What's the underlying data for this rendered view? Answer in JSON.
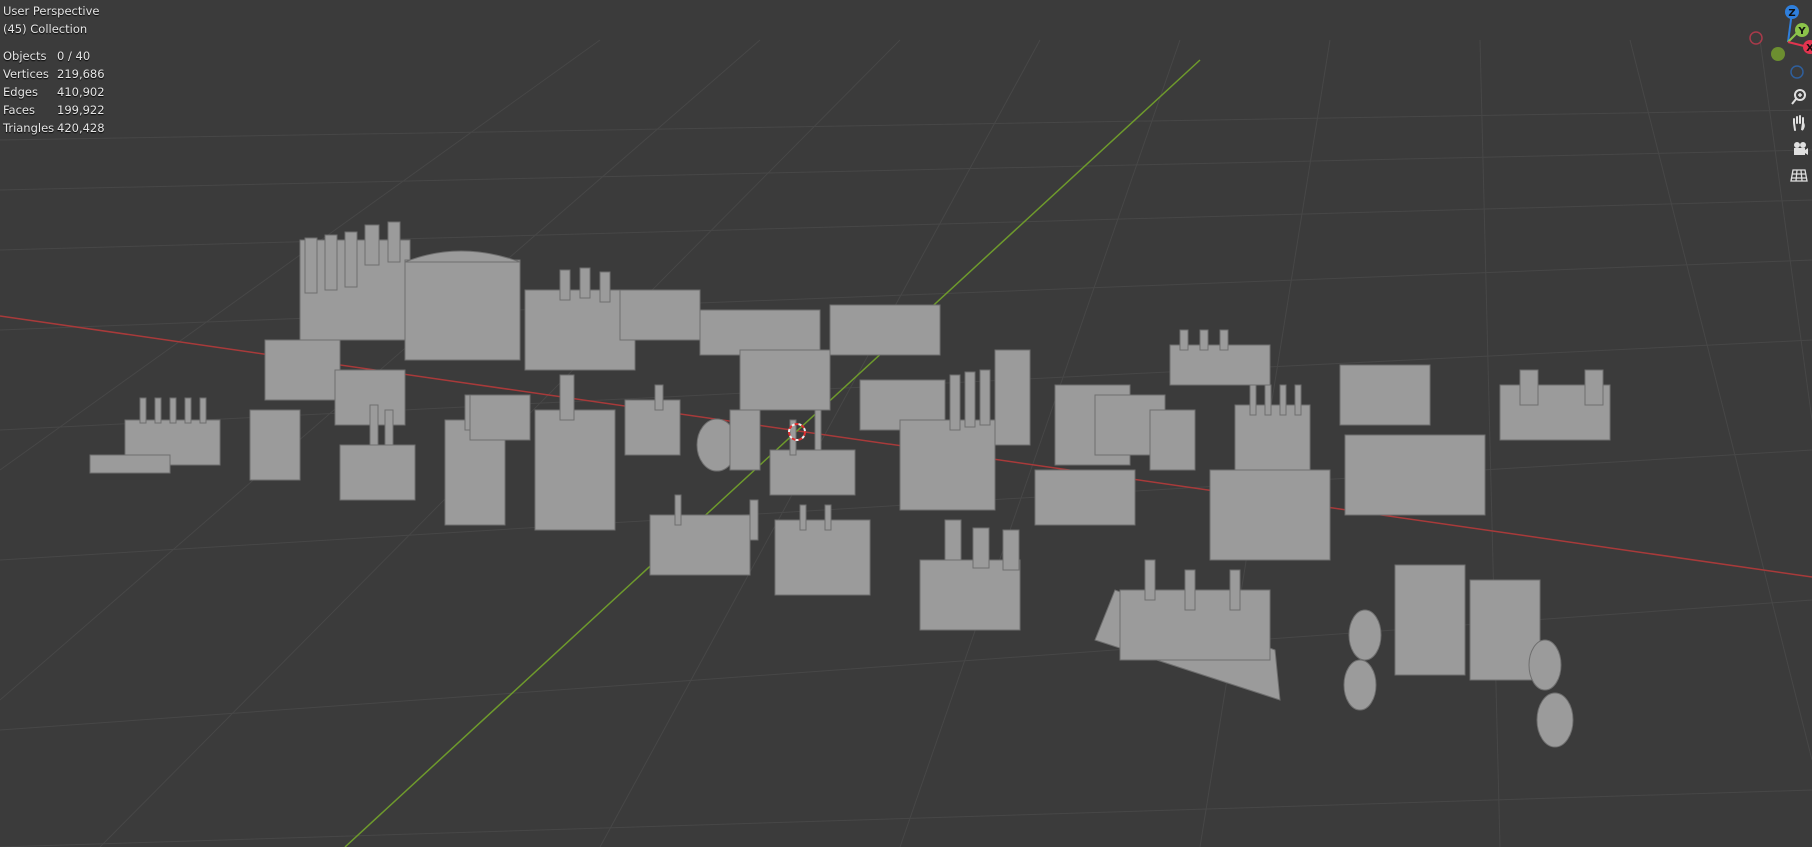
{
  "viewport": {
    "view_name": "User Perspective",
    "collection_label": "(45) Collection",
    "stats": [
      {
        "label": "Objects",
        "value": "0 / 40"
      },
      {
        "label": "Vertices",
        "value": "219,686"
      },
      {
        "label": "Edges",
        "value": "410,902"
      },
      {
        "label": "Faces",
        "value": "199,922"
      },
      {
        "label": "Triangles",
        "value": "420,428"
      }
    ]
  },
  "gizmo": {
    "axes": [
      {
        "label": "Z",
        "color": "#2f7fdc"
      },
      {
        "label": "Y",
        "color": "#8bc34a"
      },
      {
        "label": "X",
        "color": "#e2344f"
      }
    ]
  },
  "nav_buttons": [
    {
      "icon": "zoom-icon"
    },
    {
      "icon": "pan-hand-icon"
    },
    {
      "icon": "camera-icon"
    },
    {
      "icon": "grid-ortho-icon"
    }
  ],
  "colors": {
    "background": "#3b3b3b",
    "grid": "#4a4a4a",
    "x_axis": "#b33a3a",
    "y_axis": "#6d9a2a",
    "model": "#9a9a9a"
  }
}
